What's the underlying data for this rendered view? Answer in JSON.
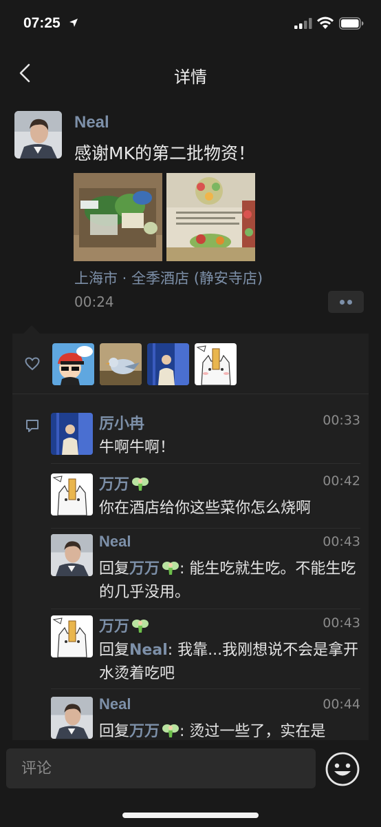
{
  "status_bar": {
    "time": "07:25"
  },
  "nav": {
    "title": "详情"
  },
  "post": {
    "author": "Neal",
    "text": "感谢MK的第二批物资！",
    "location": "上海市 · 全季酒店 (静安寺店)",
    "time": "00:24"
  },
  "comment_box": {
    "placeholder": "评论"
  },
  "comments": [
    {
      "name": "厉小冉",
      "time": "00:33",
      "text": "牛啊牛啊！"
    },
    {
      "name": "万万",
      "time": "00:42",
      "text": "你在酒店给你这些菜你怎么烧啊"
    },
    {
      "name": "Neal",
      "time": "00:43",
      "reply_prefix": "回复",
      "reply_to": "万万",
      "text": ": 能生吃就生吃。不能生吃的几乎没用。"
    },
    {
      "name": "万万",
      "time": "00:43",
      "reply_prefix": "回复",
      "reply_to": "Neal",
      "text": ": 我靠...我刚想说不会是拿开水烫着吃吧"
    },
    {
      "name": "Neal",
      "time": "00:44",
      "reply_prefix": "回复",
      "reply_to": "万万",
      "text": ": 烫过一些了，实在是"
    }
  ],
  "colors": {
    "background": "#191919",
    "panel": "#202020",
    "link": "#7d90a9"
  }
}
